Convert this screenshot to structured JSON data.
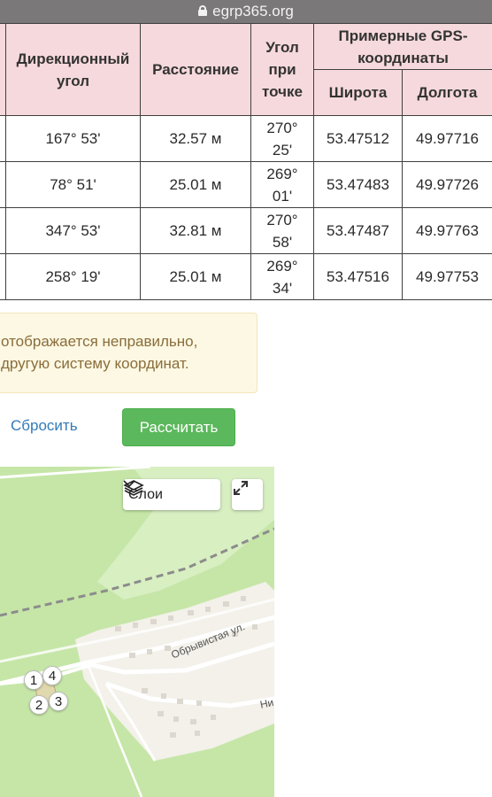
{
  "browser": {
    "url": "egrp365.org"
  },
  "table": {
    "headers": {
      "direction": "Дирекционный угол",
      "distance": "Расстояние",
      "angle": "Угол при точке",
      "gps": "Примерные GPS-координаты",
      "lat": "Широта",
      "lon": "Долгота"
    },
    "rows": [
      {
        "direction": "167° 53'",
        "distance": "32.57 м",
        "angle": "270° 25'",
        "lat": "53.47512",
        "lon": "49.97716"
      },
      {
        "direction": "78° 51'",
        "distance": "25.01 м",
        "angle": "269° 01'",
        "lat": "53.47483",
        "lon": "49.97726"
      },
      {
        "direction": "347° 53'",
        "distance": "32.81 м",
        "angle": "270° 58'",
        "lat": "53.47487",
        "lon": "49.97763"
      },
      {
        "direction": "258° 19'",
        "distance": "25.01 м",
        "angle": "269° 34'",
        "lat": "53.47516",
        "lon": "49.97753"
      }
    ]
  },
  "alert": {
    "line1": "отображается неправильно,",
    "line2": "другую систему координат."
  },
  "actions": {
    "reset_label": "Сбросить",
    "calculate_label": "Рассчитать"
  },
  "map": {
    "layers_label": "Слои",
    "street_1": "Обрывистая ул.",
    "street_2": "Ни",
    "markers": [
      "1",
      "4",
      "2",
      "3"
    ],
    "colors": {
      "grass": "#c6e6a8",
      "settlement": "#f3f1ea",
      "road": "#ffffff",
      "rail": "#8c8c8c"
    }
  }
}
